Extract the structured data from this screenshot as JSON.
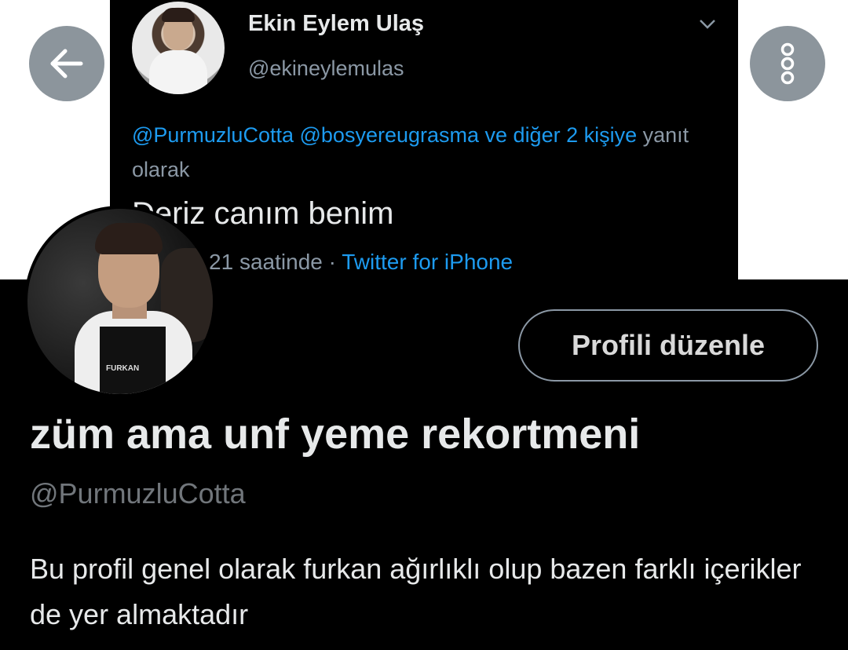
{
  "tweet": {
    "author_name": "Ekin Eylem Ulaş",
    "author_handle": "@ekineylemulas",
    "reply_mention_1": "@PurmuzluCotta",
    "reply_mention_2": "@bosyereugrasma",
    "reply_connector": " ve ",
    "reply_others": "diğer 2 kişiye",
    "reply_suffix": " yanıt olarak",
    "text": "Deriz canım benim",
    "time": "21 Oca 21 saatinde",
    "separator": " · ",
    "source": "Twitter for iPhone"
  },
  "nav": {
    "back_icon": "arrow-left-icon",
    "more_icon": "more-vertical-icon"
  },
  "profile": {
    "edit_button_label": "Profili düzenle",
    "display_name": "züm ama unf yeme rekortmeni",
    "handle": "@PurmuzluCotta",
    "bio": "Bu profil genel olarak furkan ağırlıklı olup bazen farklı içerikler de yer almaktadır",
    "avatar_apron_label": "FURKAN"
  },
  "colors": {
    "background": "#000000",
    "link_blue": "#1d9bf0",
    "secondary_text": "#8b98a5",
    "primary_text": "#e7e9ea",
    "nav_button": "#8c959c"
  }
}
